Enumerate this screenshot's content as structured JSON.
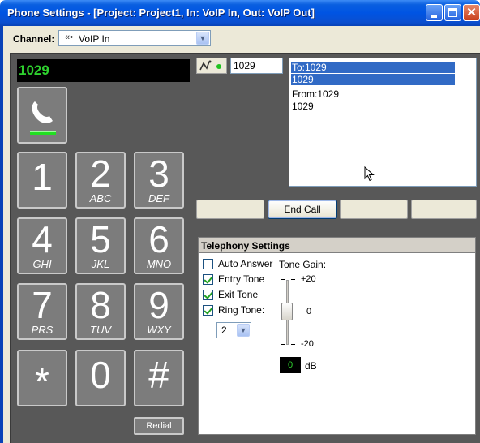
{
  "window": {
    "title": "Phone Settings - [Project: Project1, In: VoIP In, Out: VoIP Out]"
  },
  "channel": {
    "label": "Channel:",
    "value": "VoIP In"
  },
  "phone": {
    "display": "1029",
    "keys": [
      {
        "digit": "1",
        "letters": ""
      },
      {
        "digit": "2",
        "letters": "ABC"
      },
      {
        "digit": "3",
        "letters": "DEF"
      },
      {
        "digit": "4",
        "letters": "GHI"
      },
      {
        "digit": "5",
        "letters": "JKL"
      },
      {
        "digit": "6",
        "letters": "MNO"
      },
      {
        "digit": "7",
        "letters": "PRS"
      },
      {
        "digit": "8",
        "letters": "TUV"
      },
      {
        "digit": "9",
        "letters": "WXY"
      },
      {
        "digit": "*",
        "letters": ""
      },
      {
        "digit": "0",
        "letters": ""
      },
      {
        "digit": "#",
        "letters": ""
      }
    ],
    "redial_label": "Redial"
  },
  "dial": {
    "field_value": "1029"
  },
  "call_list": {
    "rows": [
      "To:1029",
      "1029",
      "From:1029",
      "1029"
    ]
  },
  "actions": {
    "end_call_label": "End Call"
  },
  "telephony": {
    "header": "Telephony Settings",
    "auto_answer_label": "Auto Answer",
    "auto_answer_checked": false,
    "entry_tone_label": "Entry Tone",
    "entry_tone_checked": true,
    "exit_tone_label": "Exit Tone",
    "exit_tone_checked": true,
    "ring_tone_label": "Ring Tone:",
    "ring_tone_checked": true,
    "ring_tone_value": "2",
    "tone_gain_label": "Tone Gain:",
    "gain_max": "+20",
    "gain_mid": "0",
    "gain_min": "-20",
    "gain_value": "0",
    "gain_unit": "dB"
  },
  "colors": {
    "display_text": "#2ed12e",
    "selection": "#316ac5",
    "panel": "#585858"
  }
}
